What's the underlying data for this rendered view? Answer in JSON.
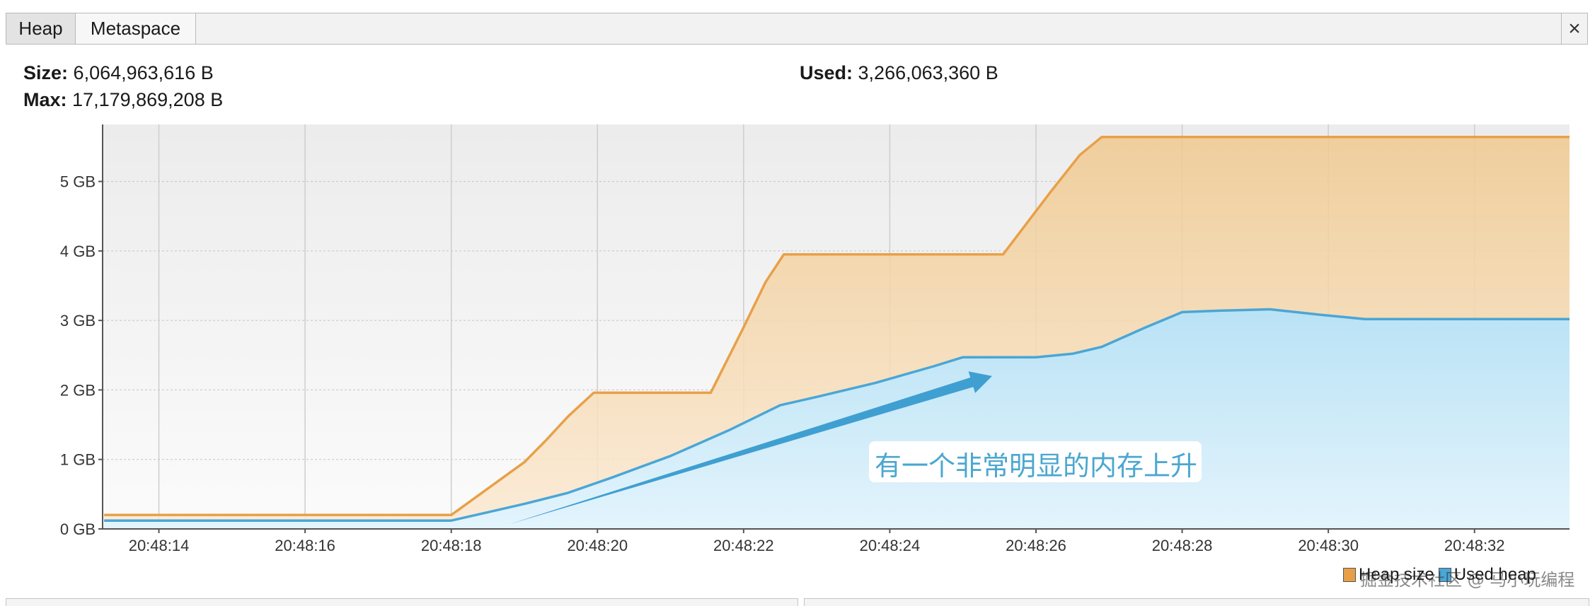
{
  "tabs": [
    {
      "label": "Heap",
      "active": true
    },
    {
      "label": "Metaspace",
      "active": false
    }
  ],
  "close_glyph": "×",
  "stats": {
    "size_label": "Size:",
    "size_value": "6,064,963,616 B",
    "max_label": "Max:",
    "max_value": "17,179,869,208 B",
    "used_label": "Used:",
    "used_value": "3,266,063,360 B"
  },
  "annotation": "有一个非常明显的内存上升",
  "watermark": "掘金技术社区 @ 马小玩编程",
  "colors": {
    "heap_line": "#e8a048",
    "used_line": "#4aa6d6",
    "plot_bg_top": "#ededed",
    "plot_bg_bottom": "#fafafa"
  },
  "chart_data": {
    "type": "area",
    "title": "",
    "xlabel": "",
    "ylabel": "",
    "ylim": [
      0,
      5.82
    ],
    "xlim": [
      13.23,
      33.3
    ],
    "y_ticks": [
      {
        "v": 0,
        "label": "0 GB"
      },
      {
        "v": 1,
        "label": "1 GB"
      },
      {
        "v": 2,
        "label": "2 GB"
      },
      {
        "v": 3,
        "label": "3 GB"
      },
      {
        "v": 4,
        "label": "4 GB"
      },
      {
        "v": 5,
        "label": "5 GB"
      }
    ],
    "x_ticks": [
      {
        "v": 14,
        "label": "20:48:14"
      },
      {
        "v": 16,
        "label": "20:48:16"
      },
      {
        "v": 18,
        "label": "20:48:18"
      },
      {
        "v": 20,
        "label": "20:48:20"
      },
      {
        "v": 22,
        "label": "20:48:22"
      },
      {
        "v": 24,
        "label": "20:48:24"
      },
      {
        "v": 26,
        "label": "20:48:26"
      },
      {
        "v": 28,
        "label": "20:48:28"
      },
      {
        "v": 30,
        "label": "20:48:30"
      },
      {
        "v": 32,
        "label": "20:48:32"
      }
    ],
    "legend_position": "bottom-right",
    "grid": true,
    "series": [
      {
        "name": "Heap size",
        "color": "#e8a048",
        "points": [
          [
            13.25,
            0.2
          ],
          [
            18.0,
            0.2
          ],
          [
            19.0,
            0.96
          ],
          [
            19.3,
            1.28
          ],
          [
            19.6,
            1.62
          ],
          [
            19.95,
            1.96
          ],
          [
            21.0,
            1.96
          ],
          [
            21.3,
            1.96
          ],
          [
            21.55,
            1.96
          ],
          [
            22.0,
            2.9
          ],
          [
            22.3,
            3.55
          ],
          [
            22.55,
            3.95
          ],
          [
            25.0,
            3.95
          ],
          [
            25.55,
            3.95
          ],
          [
            26.2,
            4.85
          ],
          [
            26.6,
            5.38
          ],
          [
            26.9,
            5.64
          ],
          [
            30.0,
            5.64
          ],
          [
            33.3,
            5.64
          ]
        ]
      },
      {
        "name": "Used heap",
        "color": "#4aa6d6",
        "points": [
          [
            13.25,
            0.12
          ],
          [
            18.0,
            0.12
          ],
          [
            18.5,
            0.24
          ],
          [
            19.0,
            0.36
          ],
          [
            19.6,
            0.52
          ],
          [
            20.2,
            0.74
          ],
          [
            21.0,
            1.05
          ],
          [
            21.8,
            1.42
          ],
          [
            22.5,
            1.78
          ],
          [
            23.0,
            1.9
          ],
          [
            23.8,
            2.1
          ],
          [
            24.6,
            2.34
          ],
          [
            25.0,
            2.47
          ],
          [
            26.0,
            2.47
          ],
          [
            26.5,
            2.52
          ],
          [
            26.9,
            2.62
          ],
          [
            27.5,
            2.9
          ],
          [
            28.0,
            3.12
          ],
          [
            28.5,
            3.14
          ],
          [
            29.2,
            3.16
          ],
          [
            29.9,
            3.08
          ],
          [
            30.5,
            3.02
          ],
          [
            33.3,
            3.02
          ]
        ]
      }
    ],
    "arrow": {
      "from": [
        18.8,
        0.07
      ],
      "to": [
        25.4,
        2.2
      ],
      "color": "#3f9fd1"
    }
  }
}
